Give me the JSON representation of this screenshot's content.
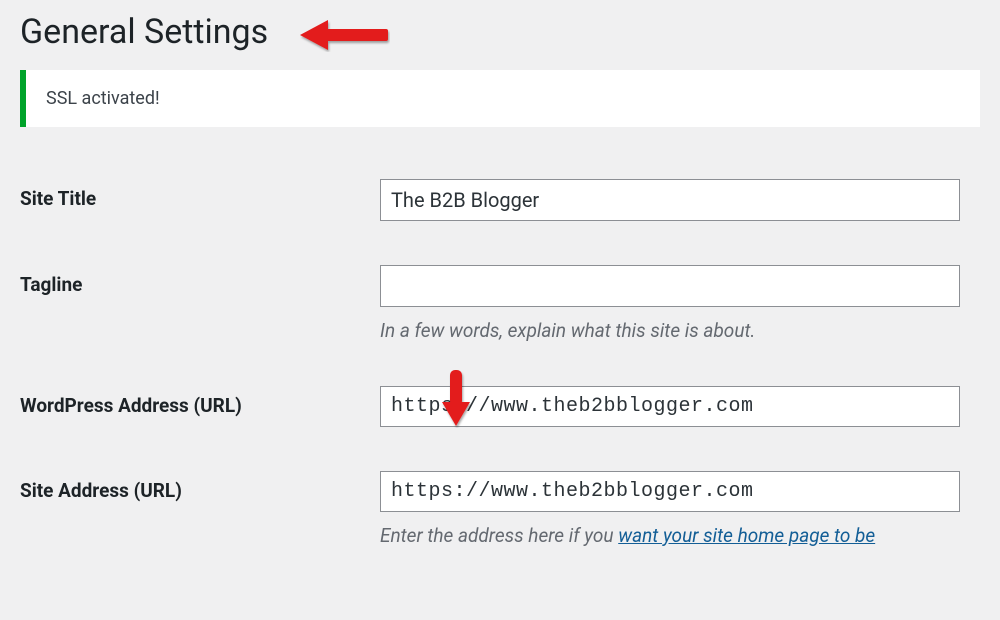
{
  "header": {
    "title": "General Settings"
  },
  "notice": {
    "message": "SSL activated!"
  },
  "fields": {
    "site_title": {
      "label": "Site Title",
      "value": "The B2B Blogger"
    },
    "tagline": {
      "label": "Tagline",
      "value": "",
      "description": "In a few words, explain what this site is about."
    },
    "wp_url": {
      "label": "WordPress Address (URL)",
      "value": "https://www.theb2bblogger.com"
    },
    "site_url": {
      "label": "Site Address (URL)",
      "value": "https://www.theb2bblogger.com",
      "description_prefix": "Enter the address here if you ",
      "description_link": "want your site home page to be"
    }
  },
  "annotations": {
    "arrow_color": "#e31b1b"
  }
}
